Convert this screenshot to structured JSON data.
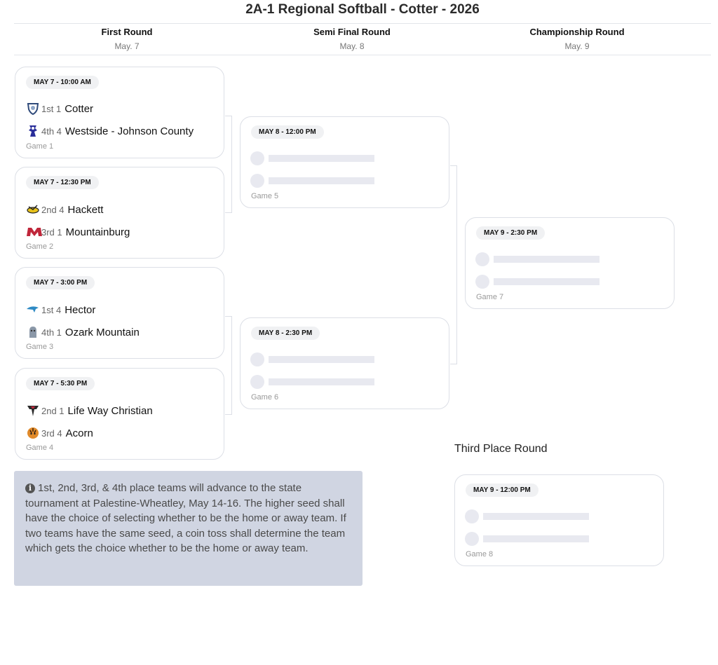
{
  "title": "2A-1 Regional Softball - Cotter - 2026",
  "rounds": [
    {
      "name": "First Round",
      "date": "May. 7"
    },
    {
      "name": "Semi Final Round",
      "date": "May. 8"
    },
    {
      "name": "Championship Round",
      "date": "May. 9"
    }
  ],
  "games": [
    {
      "time": "MAY 7 - 10:00 AM",
      "label": "Game 1",
      "teams": [
        {
          "seed": "1st 1",
          "name": "Cotter",
          "logo": "cotter-shield-icon"
        },
        {
          "seed": "4th 4",
          "name": "Westside - Johnson County",
          "logo": "westside-mascot-icon"
        }
      ]
    },
    {
      "time": "MAY 7 - 12:30 PM",
      "label": "Game 2",
      "teams": [
        {
          "seed": "2nd 4",
          "name": "Hackett",
          "logo": "hackett-hornet-icon"
        },
        {
          "seed": "3rd 1",
          "name": "Mountainburg",
          "logo": "mountainburg-m-icon"
        }
      ]
    },
    {
      "time": "MAY 7 - 3:00 PM",
      "label": "Game 3",
      "teams": [
        {
          "seed": "1st 4",
          "name": "Hector",
          "logo": "hector-wildcat-icon"
        },
        {
          "seed": "4th 1",
          "name": "Ozark Mountain",
          "logo": "ozark-mountain-icon"
        }
      ]
    },
    {
      "time": "MAY 7 - 5:30 PM",
      "label": "Game 4",
      "teams": [
        {
          "seed": "2nd 1",
          "name": "Life Way Christian",
          "logo": "lifeway-eagle-icon"
        },
        {
          "seed": "3rd 4",
          "name": "Acorn",
          "logo": "acorn-tiger-icon"
        }
      ]
    },
    {
      "time": "MAY 8 - 12:00 PM",
      "label": "Game 5"
    },
    {
      "time": "MAY 8 - 2:30 PM",
      "label": "Game 6"
    },
    {
      "time": "MAY 9 - 2:30 PM",
      "label": "Game 7"
    },
    {
      "time": "MAY 9 - 12:00 PM",
      "label": "Game 8"
    }
  ],
  "third_place_label": "Third Place Round",
  "note": "1st, 2nd, 3rd, & 4th place teams will advance to the state tournament at Palestine-Wheatley, May 14-16. The higher seed shall have the choice of selecting whether to be the home or away team. If two teams have the same seed, a coin toss shall determine the team which gets the choice whether to be the home or away team.",
  "note_icon": "info-icon",
  "colors": {
    "border": "#dcdfe6",
    "placeholder": "#e8e9f0",
    "note_bg": "#d0d5e2"
  }
}
